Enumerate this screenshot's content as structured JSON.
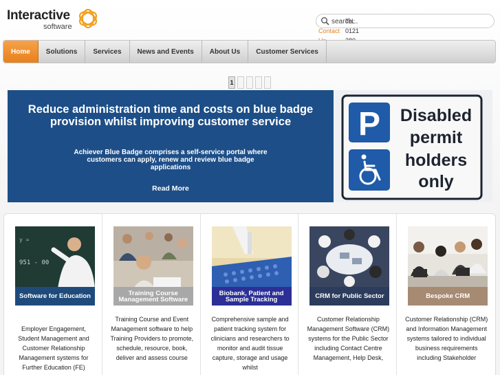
{
  "header": {
    "logo_word": "Interactive",
    "logo_sub": "software",
    "search": {
      "value": "search..."
    },
    "contact_label": "Contact Us",
    "tel_label": "Tel: 0121 380 1010"
  },
  "nav": {
    "tabs": [
      {
        "label": "Home",
        "active": true
      },
      {
        "label": "Solutions"
      },
      {
        "label": "Services"
      },
      {
        "label": "News and Events"
      },
      {
        "label": "About Us"
      },
      {
        "label": "Customer Services"
      }
    ]
  },
  "pager": {
    "pages": [
      "1",
      "",
      "",
      "",
      ""
    ],
    "current": "1"
  },
  "banner": {
    "headline": "Reduce administration time and costs on blue badge provision whilst improving customer service",
    "body": "Achiever Blue Badge comprises a self-service portal where customers can apply, renew and review blue badge applications",
    "link": "Read More",
    "sign_lines": [
      "Disabled",
      "permit",
      "holders",
      "only"
    ],
    "sign_letter": "P"
  },
  "tiles": [
    {
      "caption": "Software for Education",
      "caption_color": "#1e4b7c",
      "description": "Employer Engagement, Student Management and Customer Relationship Management systems for Further Education (FE)"
    },
    {
      "caption": "Training Course Management Software",
      "caption_color": "#a8a8a8",
      "description": "Training Course and Event Management software to help Training Providers to promote, schedule, resource, book, deliver and assess course"
    },
    {
      "caption": "Biobank, Patient and Sample Tracking",
      "caption_color": "#2b2f96",
      "description": "Comprehensive sample and patient tracking system for clinicians and researchers to monitor and audit tissue capture, storage and usage whilst"
    },
    {
      "caption": "CRM for Public Sector",
      "caption_color": "#2c3c5c",
      "description": "Customer Relationship Management Software (CRM) systems for the Public Sector including Contact Centre Management, Help Desk,"
    },
    {
      "caption": "Bespoke CRM",
      "caption_color": "#a68a72",
      "description": "Customer Relationship (CRM) and Information Management systems tailored to individual business requirements including Stakeholder"
    }
  ],
  "colors": {
    "accent": "#e8821e",
    "banner": "#1d4e87",
    "sign_blue": "#1f5ba8"
  }
}
